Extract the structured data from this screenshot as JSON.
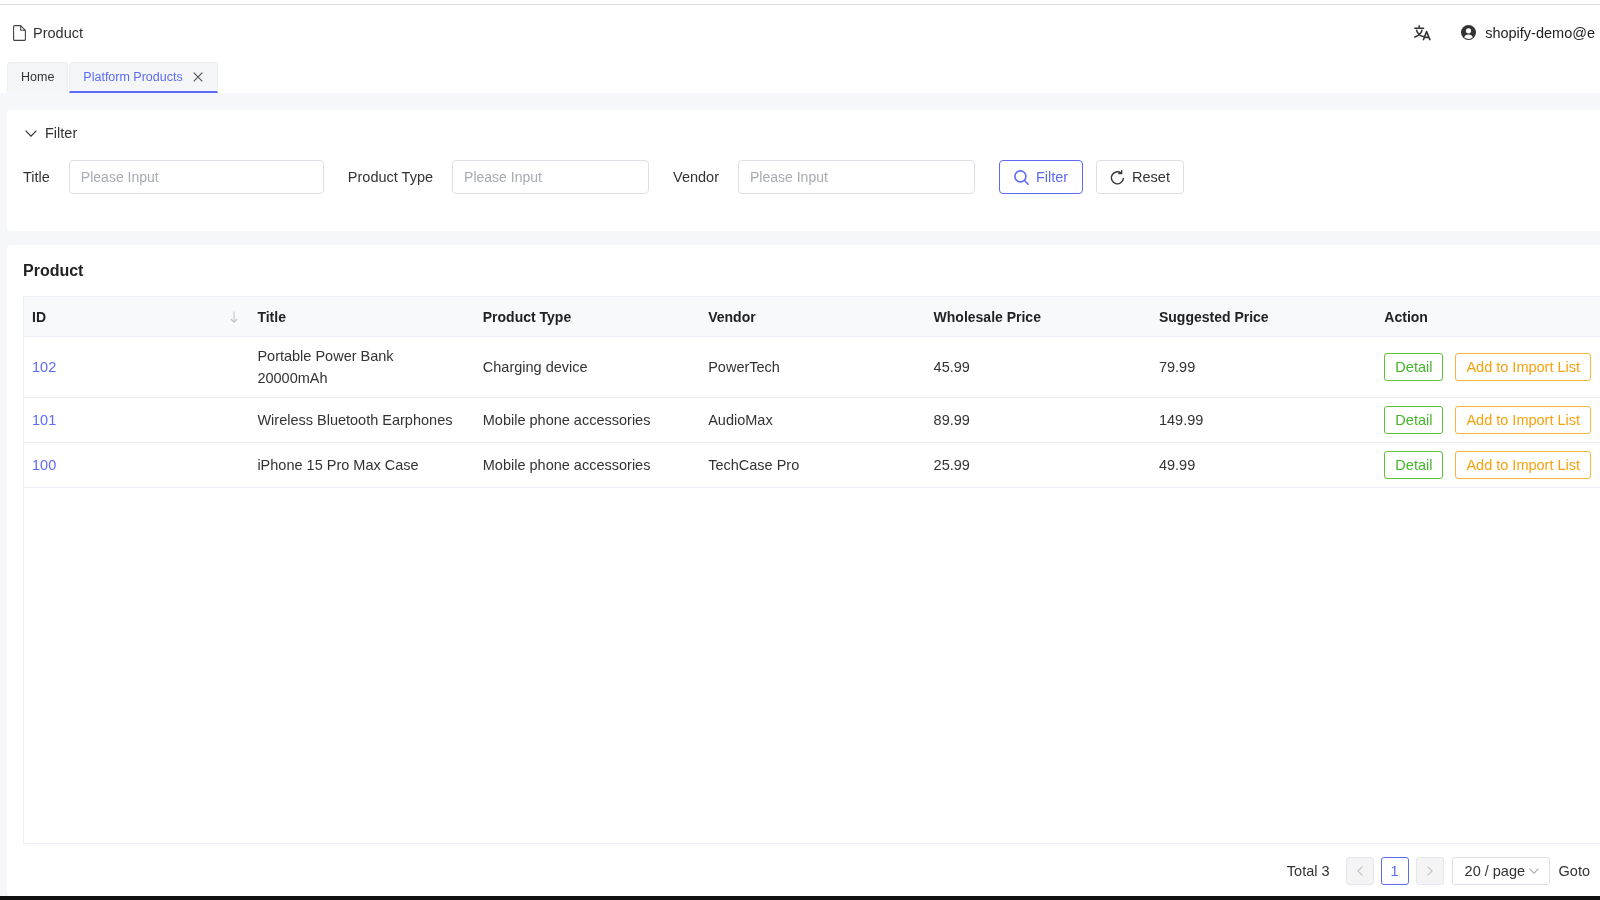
{
  "header": {
    "title": "Product",
    "user": "shopify-demo@e"
  },
  "tabs": [
    {
      "label": "Home",
      "selected": false,
      "closable": false
    },
    {
      "label": "Platform Products",
      "selected": true,
      "closable": true
    }
  ],
  "filter": {
    "title": "Filter",
    "expanded": true,
    "fields": [
      {
        "label": "Title",
        "placeholder": "Please Input"
      },
      {
        "label": "Product Type",
        "placeholder": "Please Input"
      },
      {
        "label": "Vendor",
        "placeholder": "Please Input"
      }
    ],
    "buttons": [
      {
        "label": "Filter",
        "kind": "search"
      },
      {
        "label": "Reset",
        "kind": "reset"
      }
    ]
  },
  "table": {
    "title": "Product",
    "columns": [
      {
        "label": "ID",
        "sortable": true
      },
      {
        "label": "Title",
        "sortable": false
      },
      {
        "label": "Product Type",
        "sortable": false
      },
      {
        "label": "Vendor",
        "sortable": false
      },
      {
        "label": "Wholesale Price",
        "sortable": false
      },
      {
        "label": "Suggested Price",
        "sortable": false
      },
      {
        "label": "Action",
        "sortable": false
      }
    ],
    "rows": [
      {
        "id": "102",
        "title": "Portable Power Bank 20000mAh",
        "product_type": "Charging device",
        "vendor": "PowerTech",
        "wholesale_price": "45.99",
        "suggested_price": "79.99",
        "actions": [
          {
            "label": "Detail",
            "kind": "detail"
          },
          {
            "label": "Add to Import List",
            "kind": "import"
          }
        ]
      },
      {
        "id": "101",
        "title": "Wireless Bluetooth Earphones",
        "product_type": "Mobile phone accessories",
        "vendor": "AudioMax",
        "wholesale_price": "89.99",
        "suggested_price": "149.99",
        "actions": [
          {
            "label": "Detail",
            "kind": "detail"
          },
          {
            "label": "Add to Import List",
            "kind": "import"
          }
        ]
      },
      {
        "id": "100",
        "title": "iPhone 15 Pro Max Case",
        "product_type": "Mobile phone accessories",
        "vendor": "TechCase Pro",
        "wholesale_price": "25.99",
        "suggested_price": "49.99",
        "actions": [
          {
            "label": "Detail",
            "kind": "detail"
          },
          {
            "label": "Add to Import List",
            "kind": "import"
          }
        ]
      }
    ]
  },
  "pagination": {
    "total": "Total 3",
    "prev": {
      "disabled": true
    },
    "pages": [
      {
        "label": "1",
        "selected": true
      }
    ],
    "next": {
      "disabled": true
    },
    "page_size": "20 / page",
    "goto": "Goto"
  }
}
